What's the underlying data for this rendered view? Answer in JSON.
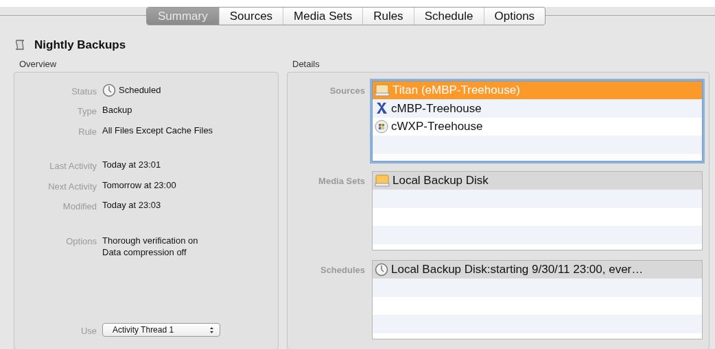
{
  "tabs": [
    {
      "label": "Summary",
      "selected": true
    },
    {
      "label": "Sources",
      "selected": false
    },
    {
      "label": "Media Sets",
      "selected": false
    },
    {
      "label": "Rules",
      "selected": false
    },
    {
      "label": "Schedule",
      "selected": false
    },
    {
      "label": "Options",
      "selected": false
    }
  ],
  "title": "Nightly Backups",
  "overview": {
    "heading": "Overview",
    "field_groups": [
      [
        {
          "label": "Status",
          "value": "Scheduled",
          "kind": "clock"
        },
        {
          "label": "Type",
          "value": "Backup"
        },
        {
          "label": "Rule",
          "value": "All Files Except Cache Files"
        }
      ],
      [
        {
          "label": "Last Activity",
          "value": "Today at 23:01"
        },
        {
          "label": "Next Activity",
          "value": "Tomorrow at 23:00"
        },
        {
          "label": "Modified",
          "value": "Today at 23:03"
        }
      ],
      [
        {
          "label": "Options",
          "value": "Thorough verification on",
          "value2": "Data compression off"
        }
      ]
    ],
    "use": {
      "label": "Use",
      "value": "Activity Thread 1"
    }
  },
  "details": {
    "heading": "Details",
    "lists": [
      {
        "label": "Sources",
        "focused": true,
        "items": [
          {
            "text": "Titan (eMBP-Treehouse)",
            "kind": "disk",
            "selected": true
          },
          {
            "text": "cMBP-Treehouse",
            "kind": "x",
            "selected": false
          },
          {
            "text": "cWXP-Treehouse",
            "kind": "windows",
            "selected": false
          }
        ]
      },
      {
        "label": "Media Sets",
        "focused": false,
        "items": [
          {
            "text": "Local Backup Disk",
            "kind": "disk",
            "selected": true
          }
        ]
      },
      {
        "label": "Schedules",
        "focused": false,
        "items": [
          {
            "text": "Local Backup Disk:starting 9/30/11 23:00, ever…",
            "kind": "clock",
            "selected": true
          }
        ]
      }
    ]
  }
}
